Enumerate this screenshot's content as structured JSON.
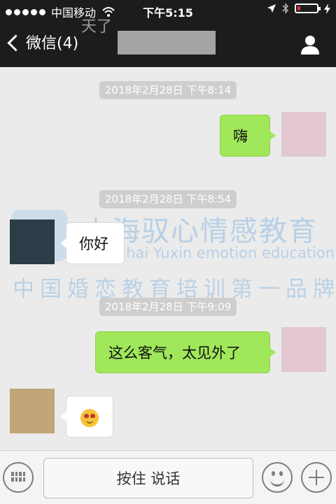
{
  "status_bar": {
    "carrier": "中国移动",
    "time": "下午5:15",
    "battery_level": 0.15,
    "battery_color": "#e8303a"
  },
  "nav": {
    "back_label": "微信(4)",
    "overlay_text": "天了",
    "profile_icon": "person-icon"
  },
  "messages": [
    {
      "type": "timestamp",
      "text": "2018年2月28日 下午8:14"
    },
    {
      "type": "message",
      "sender": "me",
      "text": "嗨"
    },
    {
      "type": "timestamp",
      "text": "2018年2月28日 下午8:54"
    },
    {
      "type": "message",
      "sender": "other",
      "text": "你好"
    },
    {
      "type": "timestamp",
      "text": "2018年2月28日 下午9:09"
    },
    {
      "type": "message",
      "sender": "me",
      "text": "这么客气，太见外了"
    },
    {
      "type": "message",
      "sender": "other",
      "emoji": "smiling-face-heart-eyes"
    }
  ],
  "watermark": {
    "name_cn": "上海驭心情感教育",
    "name_en": "Shanghai Yuxin emotion education",
    "slogan": "中国婚恋教育培训第一品牌"
  },
  "input_bar": {
    "keyboard_icon": "keyboard-icon",
    "hold_to_talk_label": "按住 说话",
    "emoji_icon": "smiley-icon",
    "add_icon": "plus-icon"
  },
  "colors": {
    "nav_background": "#1c1c1c",
    "chat_background": "#ebebeb",
    "my_bubble": "#a0e75a",
    "their_bubble": "#ffffff"
  }
}
